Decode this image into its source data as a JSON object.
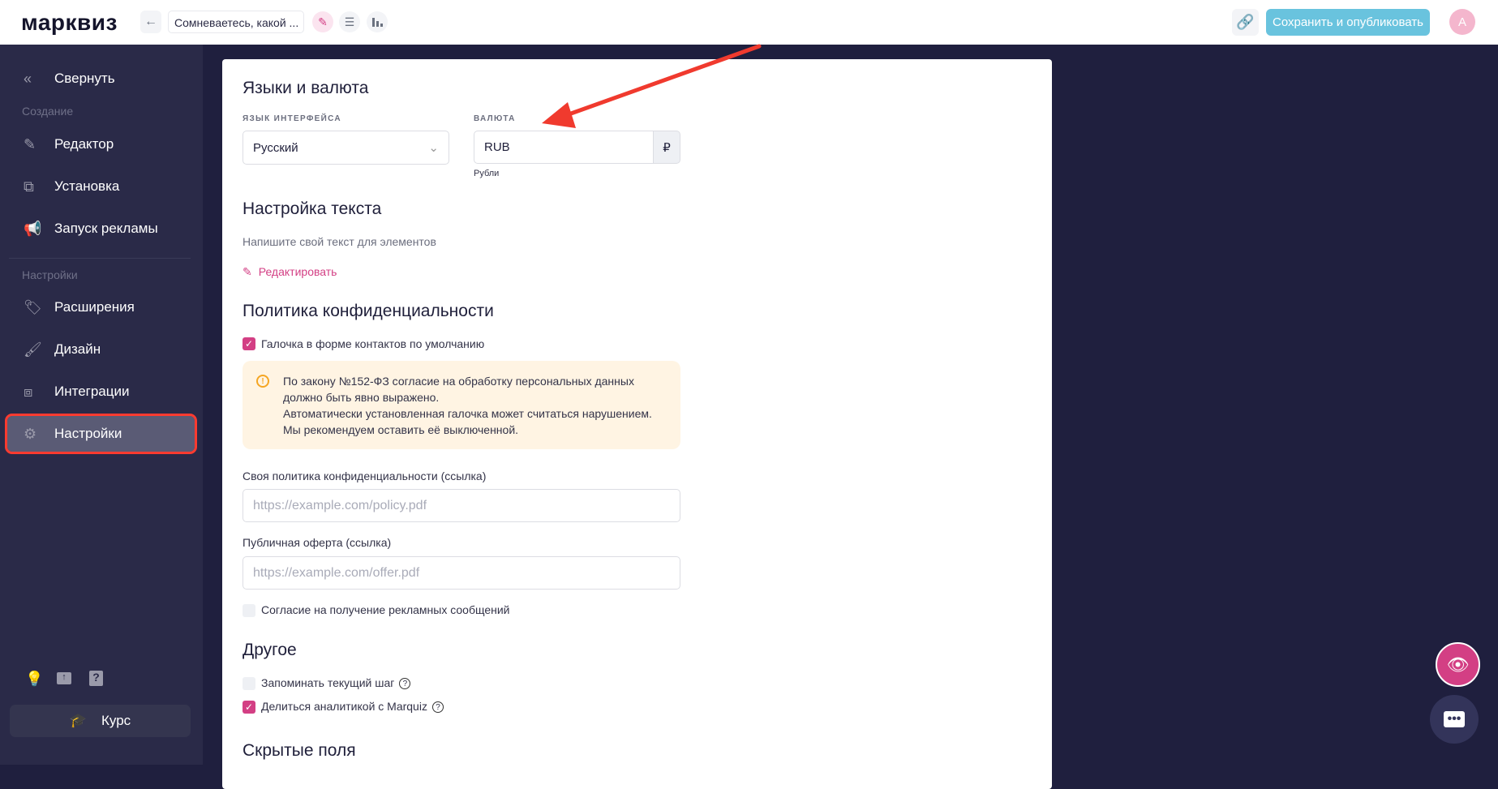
{
  "header": {
    "logo": "марквиз",
    "quiz_title": "Сомневаетесь, какой ...",
    "save_label": "Сохранить и опубликовать",
    "avatar_letter": "А"
  },
  "sidebar": {
    "collapse": "Свернуть",
    "section_create": "Создание",
    "items_create": [
      {
        "label": "Редактор",
        "icon": "pencil-icon"
      },
      {
        "label": "Установка",
        "icon": "install-icon"
      },
      {
        "label": "Запуск рекламы",
        "icon": "megaphone-icon"
      }
    ],
    "section_settings": "Настройки",
    "items_settings": [
      {
        "label": "Расширения",
        "icon": "tag-plus-icon"
      },
      {
        "label": "Дизайн",
        "icon": "brush-icon"
      },
      {
        "label": "Интеграции",
        "icon": "puzzle-icon"
      },
      {
        "label": "Настройки",
        "icon": "gear-icon",
        "active": true
      }
    ],
    "course": "Курс"
  },
  "main": {
    "lang_section": "Языки и валюта",
    "lang_label": "ЯЗЫК ИНТЕРФЕЙСА",
    "lang_value": "Русский",
    "currency_label": "ВАЛЮТА",
    "currency_value": "RUB",
    "currency_symbol": "₽",
    "currency_hint": "Рубли",
    "text_section": "Настройка текста",
    "text_desc": "Напишите свой текст для элементов",
    "edit_link": "Редактировать",
    "privacy_section": "Политика конфиденциальности",
    "privacy_checkbox": "Галочка в форме контактов по умолчанию",
    "warning_lines": [
      "По закону №152-ФЗ согласие на обработку персональных данных",
      "должно быть явно выражено.",
      "Автоматически установленная галочка может считаться нарушением.",
      "Мы рекомендуем оставить её выключенной."
    ],
    "policy_label": "Своя политика конфиденциальности (ссылка)",
    "policy_placeholder": "https://example.com/policy.pdf",
    "offer_label": "Публичная оферта (ссылка)",
    "offer_placeholder": "https://example.com/offer.pdf",
    "ads_consent": "Согласие на получение рекламных сообщений",
    "other_section": "Другое",
    "remember_step": "Запоминать текущий шаг",
    "share_analytics": "Делиться аналитикой с Marquiz",
    "hidden_section": "Скрытые поля"
  },
  "colors": {
    "accent": "#d33f84",
    "save": "#69c3de",
    "annotation": "#f03a2e"
  }
}
